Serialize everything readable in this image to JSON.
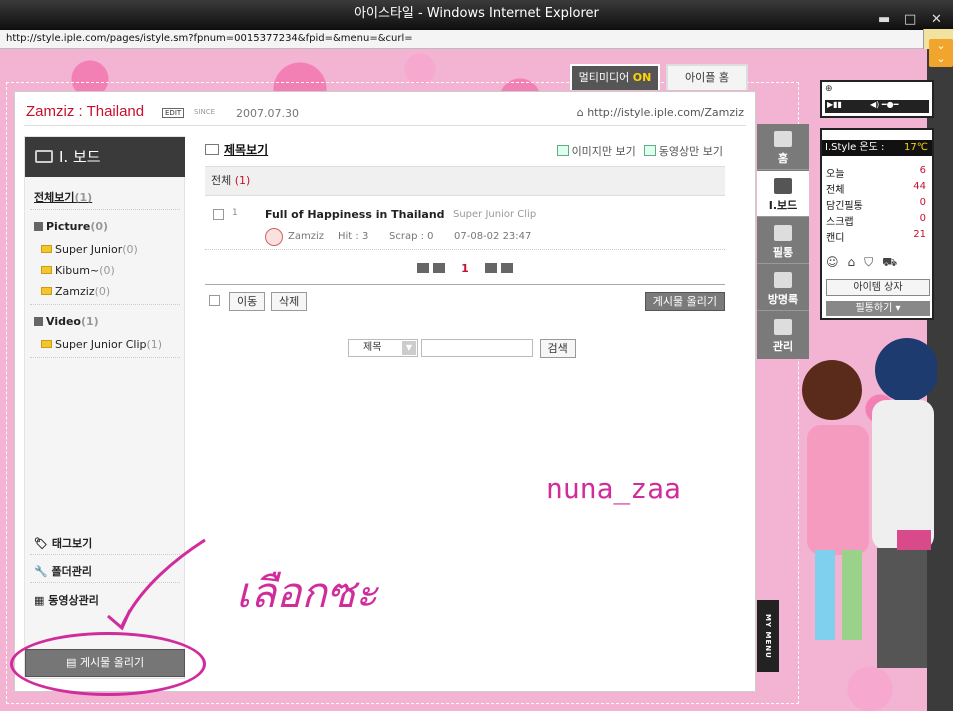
{
  "window": {
    "title": "아이스타일 - Windows Internet Explorer",
    "url": "http://style.iple.com/pages/istyle.sm?fpnum=0015377234&fpid=&menu=&curl="
  },
  "top_tabs": {
    "multimedia": "멀티미디어",
    "multimedia_state": "ON",
    "home": "아이플 홈"
  },
  "header": {
    "title": "Zamziz : Thailand",
    "edit": "EDIT",
    "since": "SINCE",
    "date": "2007.07.30",
    "url": "http://istyle.iple.com/Zamziz"
  },
  "board": {
    "title": "I. 보드"
  },
  "left_menu": {
    "all": "전체보기",
    "all_count": "(1)",
    "picture": "Picture",
    "picture_count": "(0)",
    "pic_items": [
      {
        "label": "Super Junior",
        "count": "(0)"
      },
      {
        "label": "Kibum~",
        "count": "(0)"
      },
      {
        "label": "Zamziz",
        "count": "(0)"
      }
    ],
    "video": "Video",
    "video_count": "(1)",
    "vid_items": [
      {
        "label": "Super Junior Clip",
        "count": "(1)"
      }
    ],
    "tags": "태그보기",
    "folders": "폴더관리",
    "videos": "동영상관리",
    "post": "게시물 올리기"
  },
  "content": {
    "view_title": "제목보기",
    "img_only": "이미지만 보기",
    "vid_only": "동영상만 보기",
    "category": "전체",
    "category_count": "(1)",
    "post": {
      "num": "1",
      "title": "Full of Happiness in Thailand",
      "category": "Super Junior Clip",
      "author": "Zamziz",
      "hit": "Hit : 3",
      "scrap": "Scrap : 0",
      "date": "07-08-02 23:47"
    },
    "page": "1",
    "move": "이동",
    "delete": "삭제",
    "post_btn": "게시물 올리기",
    "search_field": "제목",
    "search_btn": "검색"
  },
  "right_nav": [
    "홈",
    "I.보드",
    "필통",
    "방명록",
    "관리"
  ],
  "stats": {
    "title": "I.Style 온도 :",
    "temp": "17℃",
    "rows": [
      {
        "label": "오늘",
        "value": "6"
      },
      {
        "label": "전체",
        "value": "44"
      },
      {
        "label": "담긴필통",
        "value": "0"
      },
      {
        "label": "스크랩",
        "value": "0"
      },
      {
        "label": "캔디",
        "value": "21"
      }
    ],
    "item_box": "아이템 상자",
    "pencil": "필통하기"
  },
  "mymenu": "MY MENU",
  "annotations": {
    "name": "nuna_zaa",
    "thai": "เลือกซะ"
  },
  "colors": {
    "accent": "#c8102e",
    "annotation": "#d02c9c",
    "background": "#f3b3d3"
  }
}
